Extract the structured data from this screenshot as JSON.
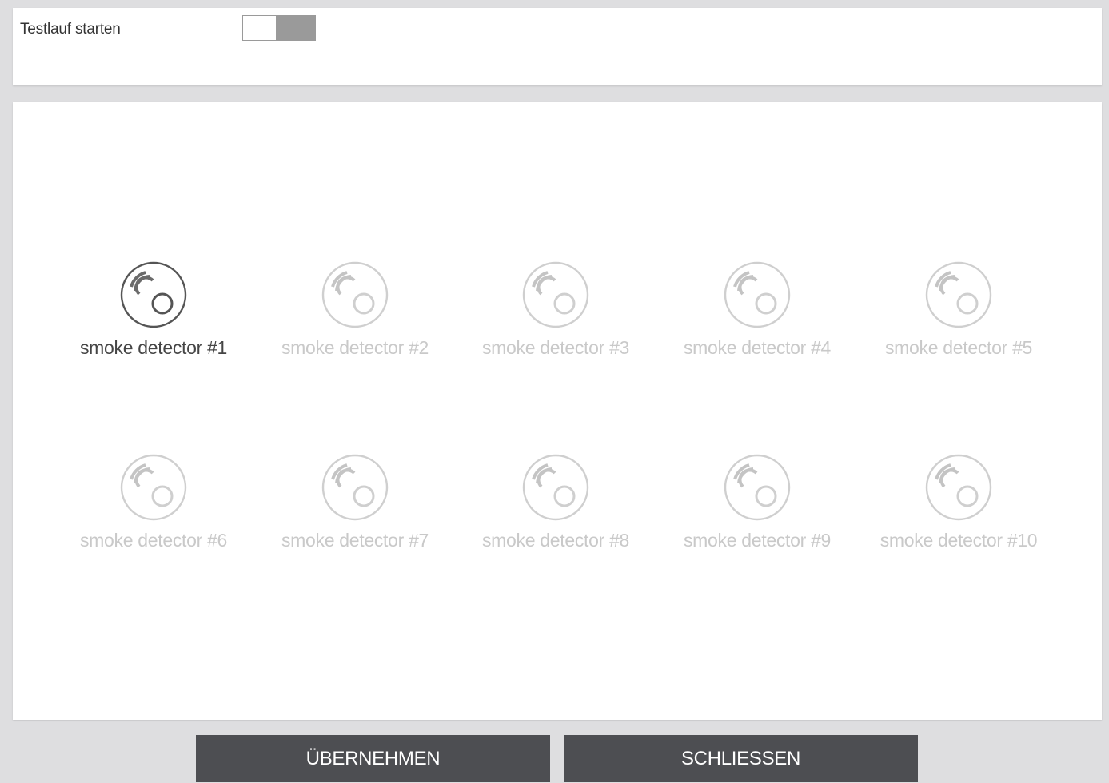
{
  "header": {
    "test_run_label": "Testlauf starten",
    "test_run_toggle": {
      "on": false
    }
  },
  "detectors": [
    {
      "label": "smoke detector #1",
      "active": true,
      "icon": "smoke-detector-icon"
    },
    {
      "label": "smoke detector #2",
      "active": false,
      "icon": "smoke-detector-icon"
    },
    {
      "label": "smoke detector #3",
      "active": false,
      "icon": "smoke-detector-icon"
    },
    {
      "label": "smoke detector #4",
      "active": false,
      "icon": "smoke-detector-icon"
    },
    {
      "label": "smoke detector #5",
      "active": false,
      "icon": "smoke-detector-icon"
    },
    {
      "label": "smoke detector #6",
      "active": false,
      "icon": "smoke-detector-icon"
    },
    {
      "label": "smoke detector #7",
      "active": false,
      "icon": "smoke-detector-icon"
    },
    {
      "label": "smoke detector #8",
      "active": false,
      "icon": "smoke-detector-icon"
    },
    {
      "label": "smoke detector #9",
      "active": false,
      "icon": "smoke-detector-icon"
    },
    {
      "label": "smoke detector #10",
      "active": false,
      "icon": "smoke-detector-icon"
    }
  ],
  "footer": {
    "apply_label": "ÜBERNEHMEN",
    "close_label": "SCHLIESSEN"
  },
  "colors": {
    "active": "#454545",
    "inactive": "#c9c9c9",
    "button_bg": "#4d4e52",
    "toggle_knob": "#9a9a9a"
  }
}
